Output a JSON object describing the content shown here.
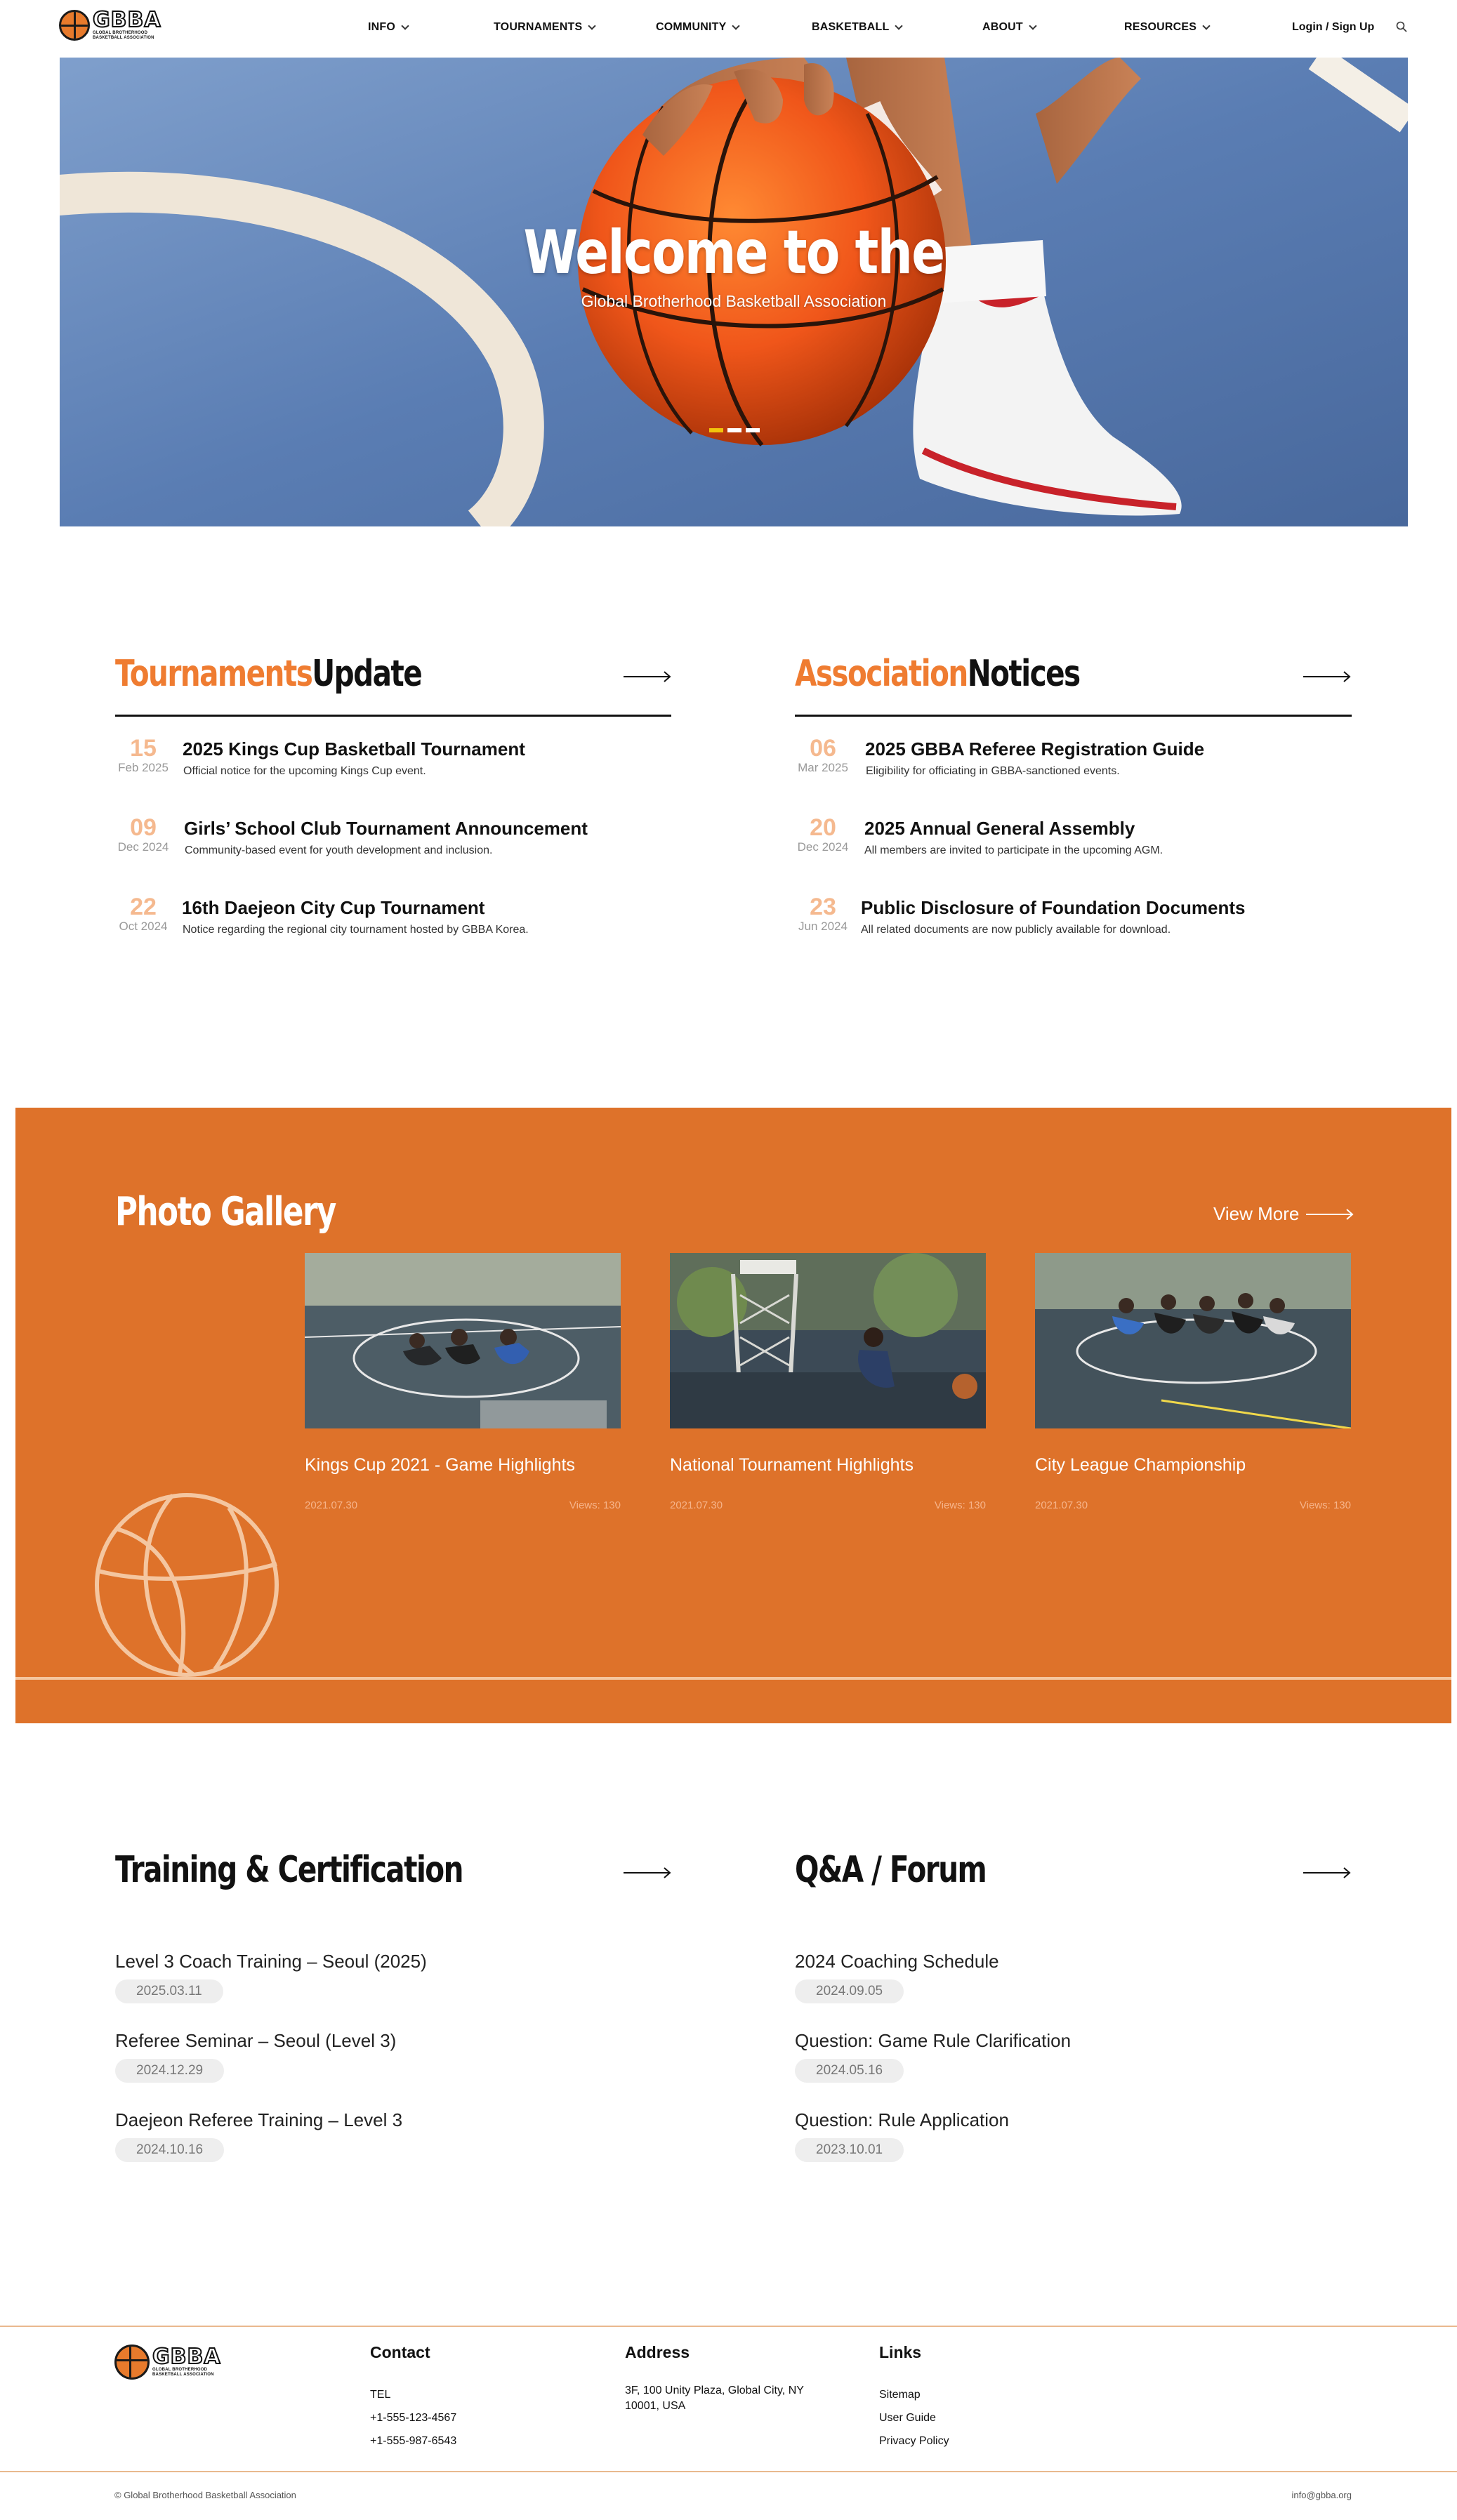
{
  "header": {
    "logo_text": "GBBA",
    "logo_sub_1": "GLOBAL BROTHERHOOD",
    "logo_sub_2": "BASKETBALL ASSOCIATION",
    "nav": [
      {
        "label": "INFO"
      },
      {
        "label": "TOURNAMENTS"
      },
      {
        "label": "COMMUNITY"
      },
      {
        "label": "BASKETBALL"
      },
      {
        "label": "ABOUT"
      },
      {
        "label": "RESOURCES"
      }
    ],
    "login_label": "Login / Sign Up",
    "search_icon": "search-icon"
  },
  "hero": {
    "title": "Welcome to the",
    "subtitle": "Global Brotherhood Basketball Association",
    "slide_count": 3,
    "active_slide": 1
  },
  "tournaments": {
    "title_accent": "Tournaments",
    "title_rest": "Update",
    "items": [
      {
        "day": "15",
        "month": "Feb 2025",
        "title": "2025 Kings Cup Basketball Tournament",
        "desc": "Official notice for the upcoming Kings Cup event."
      },
      {
        "day": "09",
        "month": "Dec 2024",
        "title": "Girls’ School Club Tournament Announcement",
        "desc": "Community-based event for youth development and inclusion."
      },
      {
        "day": "22",
        "month": "Oct 2024",
        "title": "16th Daejeon City Cup Tournament",
        "desc": "Notice regarding the regional city tournament hosted by GBBA Korea."
      }
    ]
  },
  "notices": {
    "title_accent": "Association",
    "title_rest": "Notices",
    "items": [
      {
        "day": "06",
        "month": "Mar 2025",
        "title": "2025 GBBA Referee Registration Guide",
        "desc": "Eligibility for officiating in GBBA-sanctioned events."
      },
      {
        "day": "20",
        "month": "Dec 2024",
        "title": "2025 Annual General Assembly",
        "desc": "All members are invited to participate in the upcoming AGM."
      },
      {
        "day": "23",
        "month": "Jun 2024",
        "title": "Public Disclosure of Foundation Documents",
        "desc": "All related documents are now publicly available for download."
      }
    ]
  },
  "gallery": {
    "title": "Photo Gallery",
    "view_more": "View More",
    "cards": [
      {
        "title": "Kings Cup 2021 - Game Highlights",
        "date": "2021.07.30",
        "views": "Views: 130"
      },
      {
        "title": "National Tournament Highlights",
        "date": "2021.07.30",
        "views": "Views: 130"
      },
      {
        "title": "City League Championship",
        "date": "2021.07.30",
        "views": "Views: 130"
      }
    ],
    "colors": {
      "background": "#de722a",
      "accent_light": "#f4c6a0"
    }
  },
  "training": {
    "title": "Training & Certification",
    "items": [
      {
        "title": "Level 3 Coach Training – Seoul (2025)",
        "date": "2025.03.11"
      },
      {
        "title": "Referee Seminar – Seoul (Level 3)",
        "date": "2024.12.29"
      },
      {
        "title": "Daejeon Referee Training – Level 3",
        "date": "2024.10.16"
      }
    ]
  },
  "forum": {
    "title": "Q&A / Forum",
    "items": [
      {
        "title": "2024 Coaching Schedule",
        "date": "2024.09.05"
      },
      {
        "title": "Question: Game Rule Clarification",
        "date": "2024.05.16"
      },
      {
        "title": "Question: Rule Application",
        "date": "2023.10.01"
      }
    ]
  },
  "footer": {
    "contact": {
      "heading": "Contact",
      "lines": [
        "TEL",
        "+1-555-123-4567",
        "+1-555-987-6543"
      ]
    },
    "address": {
      "heading": "Address",
      "line1": "3F, 100 Unity Plaza, Global City, NY",
      "line2": "10001, USA"
    },
    "links": {
      "heading": "Links",
      "items": [
        "Sitemap",
        "User Guide",
        "Privacy Policy"
      ]
    },
    "copyright": "© Global Brotherhood Basketball Association",
    "email": "info@gbba.org"
  },
  "colors": {
    "accent": "#ef7c31",
    "text": "#111111",
    "date_muted": "#f5b98f"
  }
}
